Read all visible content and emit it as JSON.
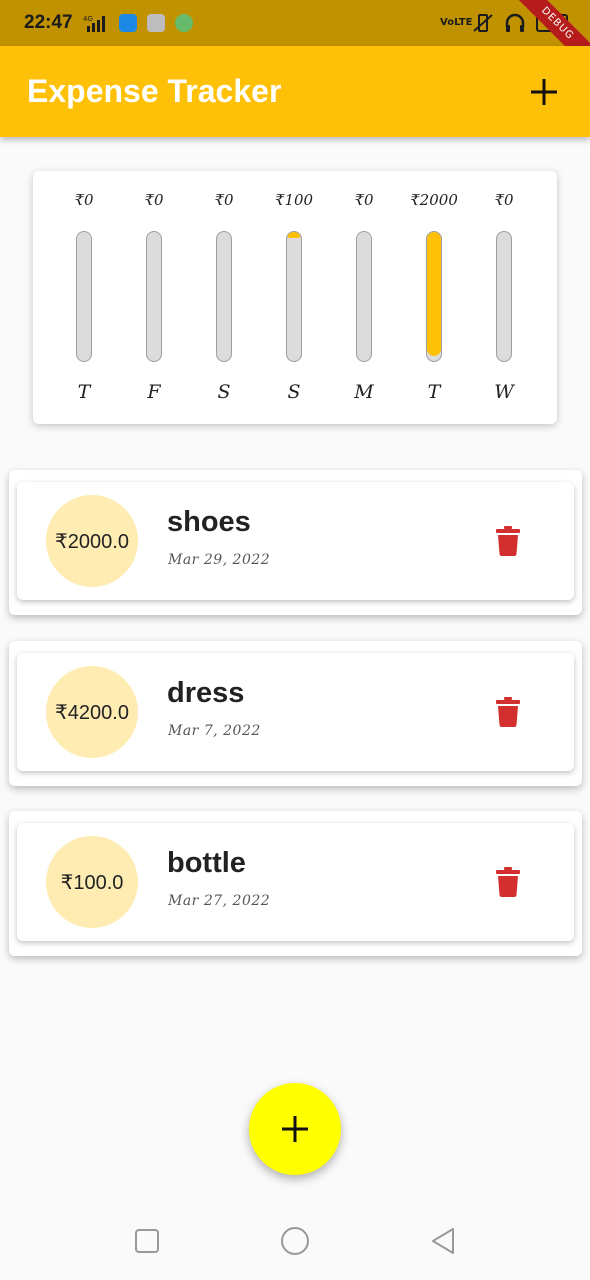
{
  "status_bar": {
    "time": "22:47",
    "signal_text": "4G",
    "volte_text": "VoLTE",
    "battery": "31"
  },
  "debug_banner": "DEBUG",
  "app_bar": {
    "title": "Expense Tracker",
    "add_icon": "plus-icon"
  },
  "chart": {
    "bars": [
      {
        "amount": "₹0",
        "day": "T",
        "fraction": 0.0
      },
      {
        "amount": "₹0",
        "day": "F",
        "fraction": 0.0
      },
      {
        "amount": "₹0",
        "day": "S",
        "fraction": 0.0
      },
      {
        "amount": "₹100",
        "day": "S",
        "fraction": 0.05
      },
      {
        "amount": "₹0",
        "day": "M",
        "fraction": 0.0
      },
      {
        "amount": "₹2000",
        "day": "T",
        "fraction": 0.96
      },
      {
        "amount": "₹0",
        "day": "W",
        "fraction": 0.0
      }
    ],
    "fill_color": "#ffc107"
  },
  "transactions": [
    {
      "amount": "₹2000.0",
      "title": "shoes",
      "date": "Mar 29, 2022"
    },
    {
      "amount": "₹4200.0",
      "title": "dress",
      "date": "Mar 7, 2022"
    },
    {
      "amount": "₹100.0",
      "title": "bottle",
      "date": "Mar 27, 2022"
    }
  ],
  "colors": {
    "primary": "#ffc107",
    "status_bar": "#c09200",
    "avatar_bg": "#ffecb3",
    "delete": "#d32f2f",
    "fab": "#ffff00"
  },
  "fab": {
    "icon": "plus-icon"
  },
  "nav": {
    "recent": "square-icon",
    "home": "circle-icon",
    "back": "triangle-back-icon"
  }
}
